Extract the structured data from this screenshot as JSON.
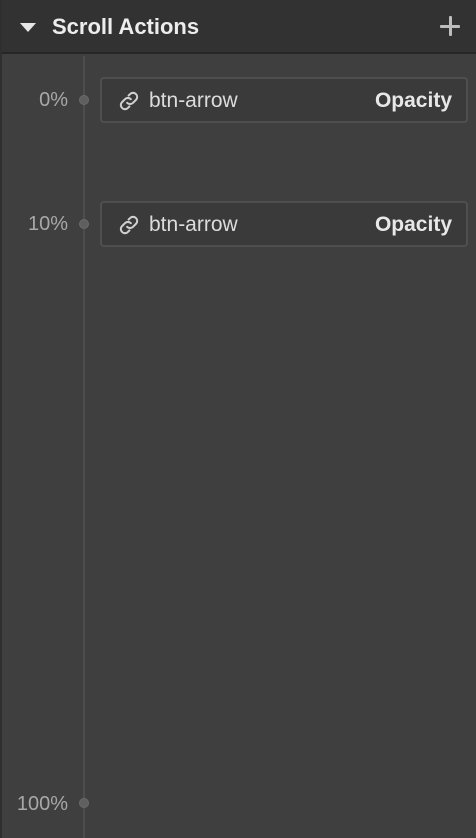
{
  "header": {
    "title": "Scroll Actions",
    "add_icon": "plus-icon",
    "collapse_icon": "caret-down-icon"
  },
  "keyframes": [
    {
      "percent": "0%",
      "action": {
        "target": "btn-arrow",
        "property": "Opacity",
        "icon": "link-icon"
      }
    },
    {
      "percent": "10%",
      "action": {
        "target": "btn-arrow",
        "property": "Opacity",
        "icon": "link-icon"
      }
    },
    {
      "percent": "100%"
    }
  ],
  "colors": {
    "panel_bg": "#3f3f3f",
    "header_bg": "#323232",
    "text": "#e8e8e8",
    "muted": "#a8a8a8"
  }
}
